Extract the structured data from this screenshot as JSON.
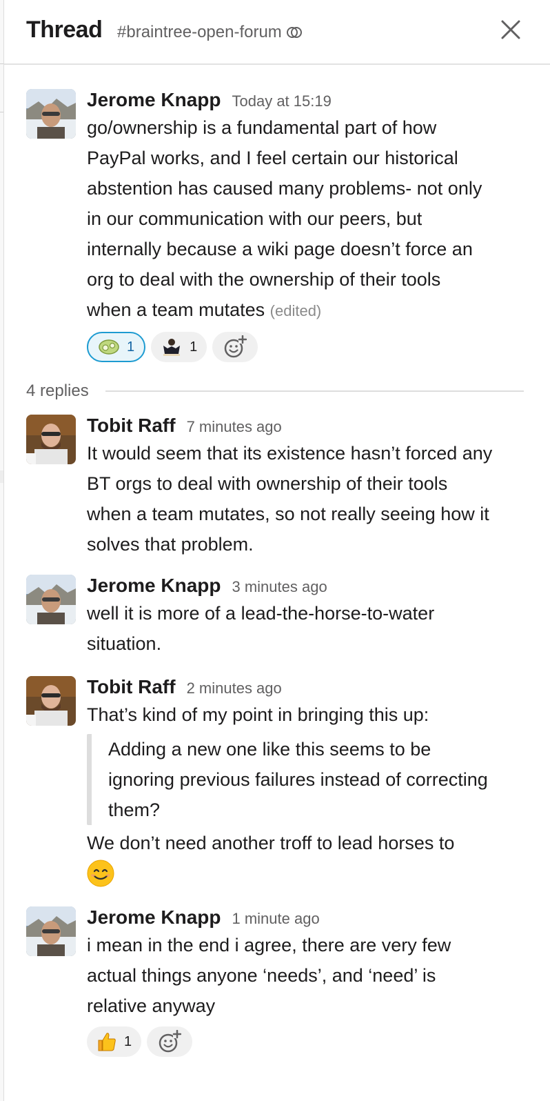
{
  "header": {
    "title": "Thread",
    "channel": "#braintree-open-forum"
  },
  "messages": [
    {
      "author": "Jerome Knapp",
      "time": "Today at 15:19",
      "lines": [
        "go/ownership is a fundamental part of how",
        "PayPal works, and I feel certain our historical",
        "abstention has caused many problems- not only",
        "in our communication with our peers, but",
        "internally because a wiki page doesn’t force an",
        "org to deal with the ownership of their tools",
        "when a team mutates"
      ],
      "edited": "(edited)",
      "reactions": [
        {
          "emoji": "green-blob-emoji",
          "count": "1",
          "active": true
        },
        {
          "emoji": "person-shrug-emoji",
          "count": "1",
          "active": false
        }
      ]
    },
    {
      "author": "Tobit Raff",
      "time": "7 minutes ago",
      "lines": [
        "It would seem that its existence hasn’t forced any",
        "BT orgs to deal with ownership of their tools",
        "when a team mutates, so not really seeing how it",
        "solves that problem."
      ]
    },
    {
      "author": "Jerome Knapp",
      "time": "3 minutes ago",
      "lines": [
        "well it is more of a lead-the-horse-to-water",
        "situation."
      ]
    },
    {
      "author": "Tobit Raff",
      "time": "2 minutes ago",
      "lines": [
        "That’s kind of my point in bringing this up:"
      ],
      "quote": [
        "Adding a new one like this seems to be",
        "ignoring previous failures instead of correcting",
        "them?"
      ],
      "after": [
        "We don’t need another troff to lead horses to"
      ],
      "emoji": "smiling-face-emoji"
    },
    {
      "author": "Jerome Knapp",
      "time": "1 minute ago",
      "lines": [
        "i mean in the end i agree, there are very few",
        "actual things anyone ‘needs’, and ‘need’ is",
        "relative anyway"
      ],
      "reactions": [
        {
          "emoji": "thumbs-up-emoji",
          "count": "1",
          "active": false
        }
      ]
    }
  ],
  "replies_label": "4 replies"
}
